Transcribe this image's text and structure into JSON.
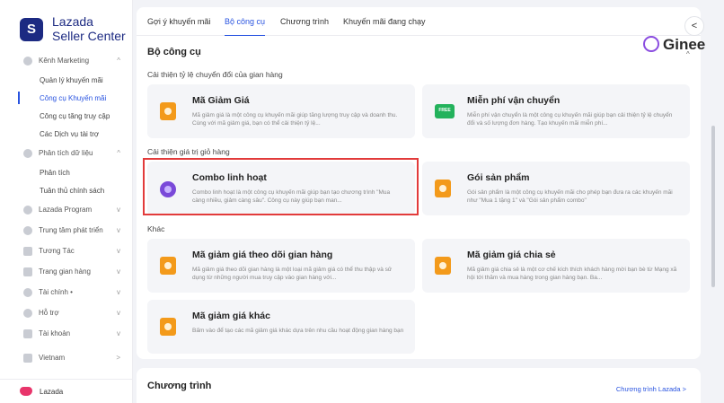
{
  "brand": {
    "logo": "S",
    "name": "Lazada",
    "sub": "Seller Center"
  },
  "sidebar": {
    "items": [
      {
        "label": "Kênh Marketing",
        "arrow": "^"
      },
      {
        "label": "Quản lý khuyến mãi",
        "sub": true
      },
      {
        "label": "Công cụ Khuyến mãi",
        "sub": true,
        "active": true
      },
      {
        "label": "Công cụ tăng truy cập",
        "sub": true
      },
      {
        "label": "Các Dịch vụ tài trợ",
        "sub": true
      },
      {
        "label": "Phân tích dữ liệu",
        "arrow": "^"
      },
      {
        "label": "Phân tích",
        "sub": true
      },
      {
        "label": "Tuân thủ chính sách",
        "sub": true
      },
      {
        "label": "Lazada Program",
        "arrow": "v"
      },
      {
        "label": "Trung tâm phát triển",
        "arrow": "v"
      },
      {
        "label": "Tương Tác",
        "arrow": "v"
      },
      {
        "label": "Trang gian hàng",
        "arrow": "v"
      },
      {
        "label": "Tài chính •",
        "arrow": "v"
      },
      {
        "label": "Hỗ trợ",
        "arrow": "v"
      },
      {
        "label": "Tài khoản",
        "arrow": "v"
      },
      {
        "label": "Vietnam",
        "arrow": ">"
      }
    ],
    "footer": "Lazada"
  },
  "tabs": [
    {
      "label": "Gợi ý khuyến mãi"
    },
    {
      "label": "Bộ công cụ",
      "active": true
    },
    {
      "label": "Chương trình"
    },
    {
      "label": "Khuyến mãi đang chạy"
    }
  ],
  "collapse": "<",
  "ginee": "Ginee",
  "toolkit": {
    "title": "Bộ công cụ",
    "toggle": "^",
    "sections": [
      {
        "label": "Cải thiện tỷ lệ chuyển đổi của gian hàng",
        "tools": [
          {
            "title": "Mã Giảm Giá",
            "desc": "Mã giảm giá là một công cụ khuyến mãi giúp tăng lượng truy cập và doanh thu. Cùng với mã giảm giá, bạn có thể cải thiện tỷ lệ...",
            "icon": "voucher-icon"
          },
          {
            "title": "Miễn phí vận chuyển",
            "desc": "Miễn phí vận chuyển là một công cụ khuyến mãi giúp bạn cải thiện tỷ lệ chuyển đổi và số lượng đơn hàng. Tạo khuyến mãi miễn phí...",
            "icon": "free-shipping-icon",
            "badge": "FREE"
          }
        ]
      },
      {
        "label": "Cải thiện giá trị giỏ hàng",
        "tools": [
          {
            "title": "Combo linh hoạt",
            "desc": "Combo linh hoạt là một công cụ khuyến mãi giúp bạn tạo chương trình \"Mua càng nhiều, giảm càng sâu\". Công cụ này giúp bạn man...",
            "icon": "combo-icon"
          },
          {
            "title": "Gói sản phẩm",
            "desc": "Gói sản phẩm là một công cụ khuyến mãi cho phép bạn đưa ra các khuyến mãi như \"Mua 1 tặng 1\" và \"Gói sản phẩm combo\"",
            "icon": "bundle-icon"
          }
        ]
      },
      {
        "label": "Khác",
        "tools": [
          {
            "title": "Mã giảm giá theo dõi gian hàng",
            "desc": "Mã giảm giá theo dõi gian hàng là một loại mã giảm giá có thể thu thập và sử dụng từ những người mua truy cập vào gian hàng với...",
            "icon": "follow-voucher-icon"
          },
          {
            "title": "Mã giảm giá chia sẻ",
            "desc": "Mã giảm giá chia sẻ là một cơ chế kích thích khách hàng mời bạn bè từ Mạng xã hội tới thăm và mua hàng trong gian hàng bạn. Ba...",
            "icon": "share-voucher-icon"
          },
          {
            "title": "Mã giảm giá khác",
            "desc": "Bấm vào để tạo các mã giảm giá khác dựa trên nhu cầu hoạt động gian hàng bạn",
            "icon": "other-voucher-icon"
          }
        ]
      }
    ]
  },
  "program": {
    "title": "Chương trình",
    "link": "Chương trình Lazada >"
  }
}
